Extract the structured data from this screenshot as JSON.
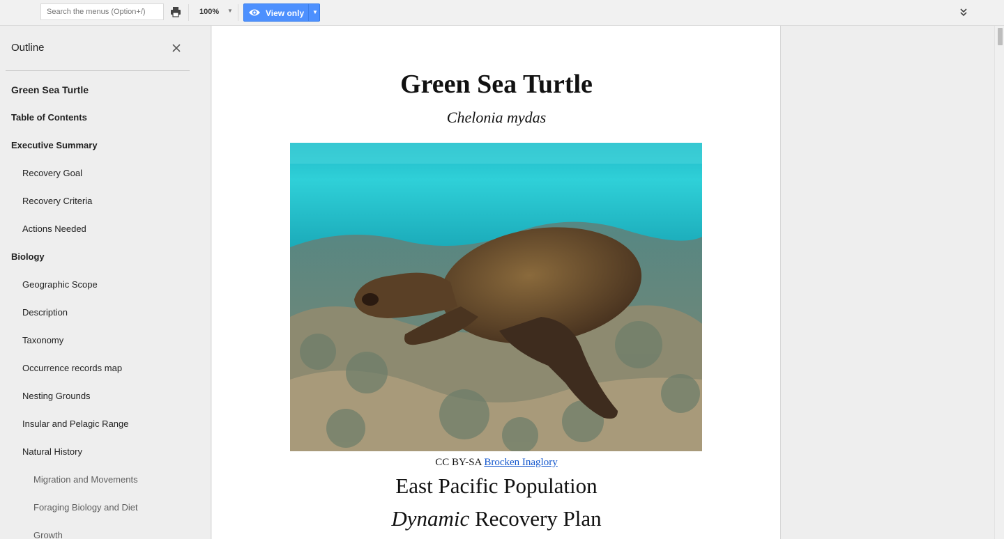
{
  "toolbar": {
    "search_placeholder": "Search the menus (Option+/)",
    "zoom": "100%",
    "view_mode_label": "View only",
    "accent_color": "#4d90fe"
  },
  "outline": {
    "title": "Outline",
    "items": [
      {
        "label": "Green Sea Turtle",
        "level": 1
      },
      {
        "label": "Table of Contents",
        "level": 1
      },
      {
        "label": "Executive Summary",
        "level": 1
      },
      {
        "label": "Recovery Goal",
        "level": 2
      },
      {
        "label": "Recovery Criteria",
        "level": 2
      },
      {
        "label": "Actions Needed",
        "level": 2
      },
      {
        "label": "Biology",
        "level": 1
      },
      {
        "label": "Geographic Scope",
        "level": 2
      },
      {
        "label": "Description",
        "level": 2
      },
      {
        "label": "Taxonomy",
        "level": 2
      },
      {
        "label": "Occurrence records map",
        "level": 2
      },
      {
        "label": "Nesting Grounds",
        "level": 2
      },
      {
        "label": "Insular and Pelagic Range",
        "level": 2
      },
      {
        "label": "Natural History",
        "level": 2
      },
      {
        "label": "Migration and Movements",
        "level": 3
      },
      {
        "label": "Foraging Biology and Diet",
        "level": 3
      },
      {
        "label": "Growth",
        "level": 3
      }
    ]
  },
  "document": {
    "title": "Green Sea Turtle",
    "subtitle": "Chelonia mydas",
    "caption_prefix": "CC BY-SA",
    "caption_link": "Brocken Inaglory",
    "heading_population": "East Pacific Population",
    "heading_plan_italic": "Dynamic",
    "heading_plan_rest": " Recovery Plan"
  }
}
